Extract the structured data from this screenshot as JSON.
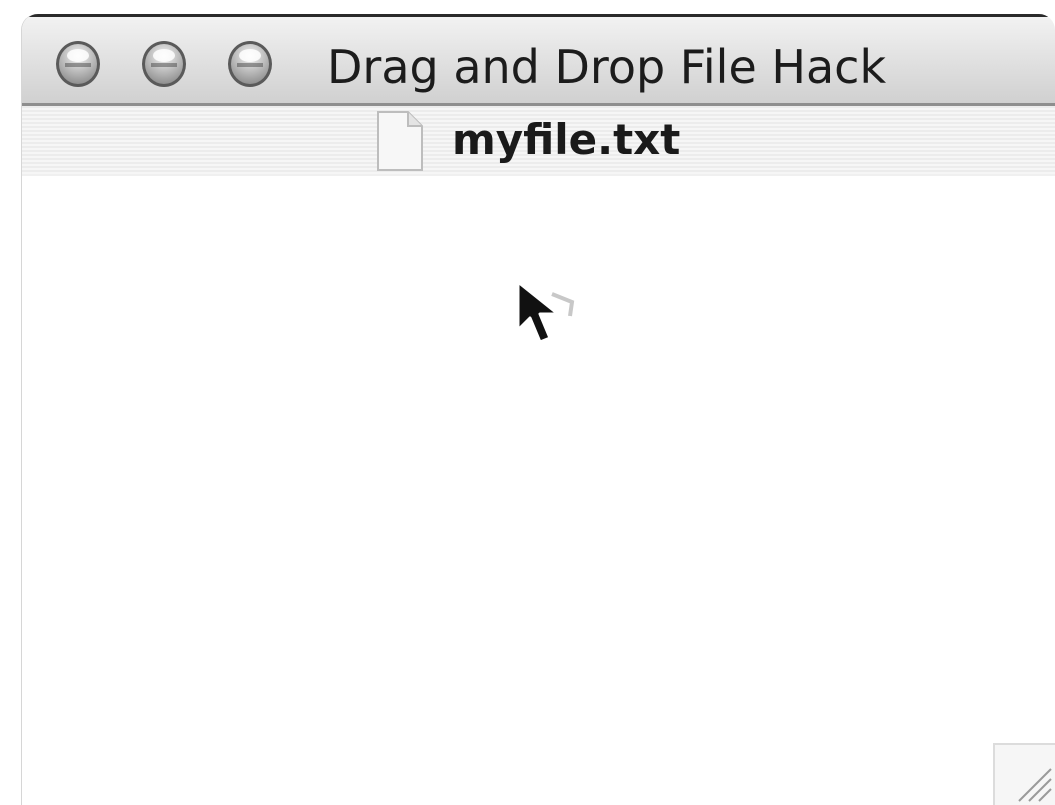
{
  "window": {
    "title": "Drag and Drop File Hack",
    "buttons": [
      {
        "name": "close",
        "icon": "close-traffic-light"
      },
      {
        "name": "minimize",
        "icon": "minimize-traffic-light"
      },
      {
        "name": "zoom",
        "icon": "zoom-traffic-light"
      }
    ]
  },
  "path_bar": {
    "file_name": "myfile.txt",
    "icon": "document-icon"
  },
  "content": {
    "cursor_icon": "arrow-cursor-icon"
  },
  "colors": {
    "title_text": "#1c1c1c",
    "background": "#ffffff"
  }
}
